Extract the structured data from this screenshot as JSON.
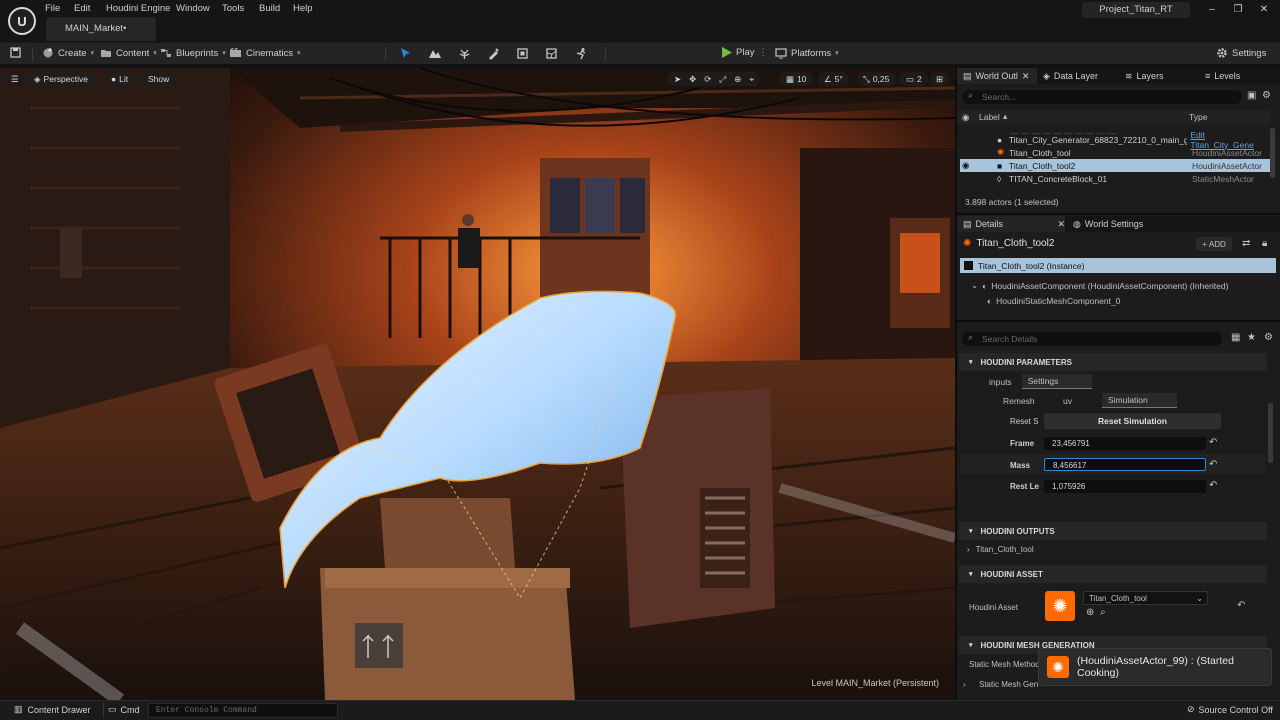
{
  "menu": [
    "File",
    "Edit",
    "Houdini Engine",
    "Window",
    "Tools",
    "Build",
    "Help"
  ],
  "document_tab": "MAIN_Market•",
  "project_name": "Project_Titan_RT",
  "toolbar": {
    "create": "Create",
    "content": "Content",
    "blueprints": "Blueprints",
    "cinematics": "Cinematics",
    "play": "Play",
    "platforms": "Platforms",
    "settings": "Settings"
  },
  "viewport": {
    "perspective": "Perspective",
    "lit": "Lit",
    "show": "Show",
    "grid_snap": "10",
    "angle_snap": "5°",
    "scale_snap": "0,25",
    "camera_speed": "2",
    "level_label": "Level  MAIN_Market (Persistent)"
  },
  "outliner": {
    "tabs": [
      "World Outl",
      "Data Layer",
      "Layers",
      "Levels"
    ],
    "search_placeholder": "Search...",
    "col_label": "Label",
    "col_type": "Type",
    "rows": [
      {
        "label": "Titan_City_Generator_68823_72210_0_main_g",
        "type": "Edit Titan_City_Gene"
      },
      {
        "label": "Titan_Cloth_tool",
        "type": "HoudiniAssetActor"
      },
      {
        "label": "Titan_Cloth_tool2",
        "type": "HoudiniAssetActor"
      },
      {
        "label": "TITAN_ConcreteBlock_01",
        "type": "StaticMeshActor"
      }
    ],
    "summary": "3.898 actors (1 selected)"
  },
  "details": {
    "tab": "Details",
    "world_settings_tab": "World Settings",
    "actor_name": "Titan_Cloth_tool2",
    "add_label": "ADD",
    "instance": "Titan_Cloth_tool2 (Instance)",
    "component": "HoudiniAssetComponent (HoudiniAssetComponent) (Inherited)",
    "sub_component": "HoudiniStaticMeshComponent_0",
    "search_placeholder": "Search Details",
    "params_header": "HOUDINI PARAMETERS",
    "tabs1": [
      "inputs",
      "Settings"
    ],
    "tabs2": [
      "Remesh",
      "uv",
      "Simulation"
    ],
    "reset_label": "Reset S",
    "reset_button": "Reset Simulation",
    "frame_label": "Frame",
    "frame_value": "23,456791",
    "mass_label": "Mass",
    "mass_value": "8,456617",
    "restle_label": "Rest Le",
    "restle_value": "1,075926",
    "outputs_header": "HOUDINI OUTPUTS",
    "output_item": "Titan_Cloth_tool",
    "asset_header": "HOUDINI ASSET",
    "houdini_asset_label": "Houdini Asset",
    "asset_value": "Titan_Cloth_tool",
    "meshgen_header": "HOUDINI MESH GENERATION",
    "static_mesh_method": "Static Mesh Method",
    "static_mesh_gen": "Static Mesh Gen"
  },
  "notification": "(HoudiniAssetActor_99) : (Started Cooking)",
  "status": {
    "content_drawer": "Content Drawer",
    "cmd": "Cmd",
    "console_placeholder": "Enter Console Command",
    "source_control": "Source Control Off"
  },
  "colors": {
    "accent": "#2f87d8",
    "selection": "#a7c4db",
    "play": "#6fbf3c",
    "houdini": "#ff6a00"
  }
}
